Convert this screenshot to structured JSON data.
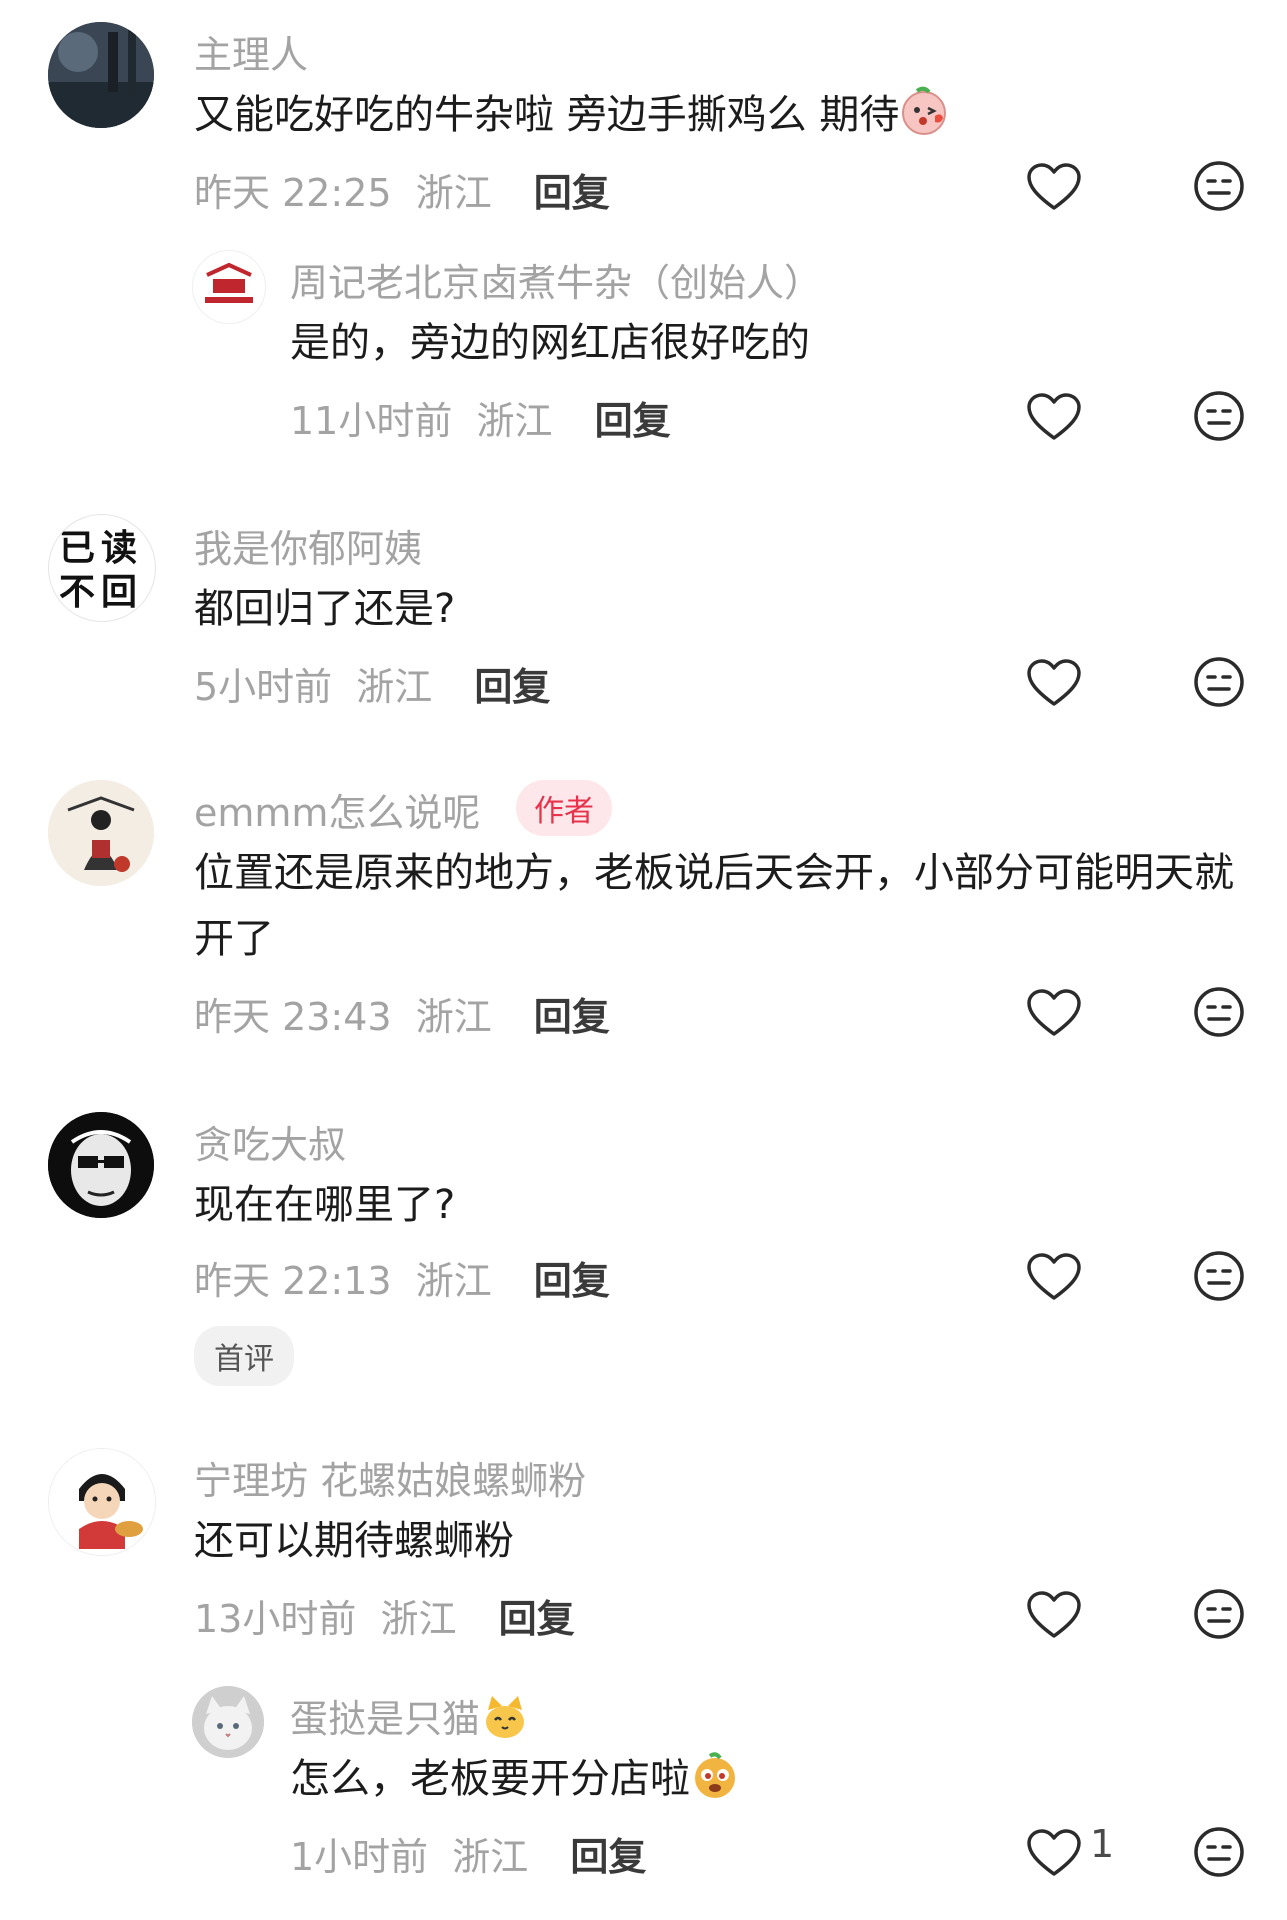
{
  "comments": [
    {
      "name": "主理人",
      "text": "又能吃好吃的牛杂啦   旁边手撕鸡么  期待",
      "emoji": "kiss-face-emoji",
      "time": "昨天 22:25",
      "location": "浙江",
      "reply_label": "回复",
      "replies": [
        {
          "name": "周记老北京卤煮牛杂（创始人）",
          "text": "是的，旁边的网红店很好吃的",
          "time": "11小时前",
          "location": "浙江",
          "reply_label": "回复"
        }
      ]
    },
    {
      "name": "我是你郁阿姨",
      "avatar_text": [
        "已读",
        "不回"
      ],
      "text": "都回归了还是?",
      "time": "5小时前",
      "location": "浙江",
      "reply_label": "回复"
    },
    {
      "name": "emmm怎么说呢",
      "tag": "作者",
      "text": "位置还是原来的地方，老板说后天会开，小部分可能明天就开了",
      "time": "昨天 23:43",
      "location": "浙江",
      "reply_label": "回复"
    },
    {
      "name": "贪吃大叔",
      "text": "现在在哪里了?",
      "time": "昨天 22:13",
      "location": "浙江",
      "reply_label": "回复",
      "badge": "首评"
    },
    {
      "name": "宁理坊 花螺姑娘螺蛳粉",
      "text": "还可以期待螺蛳粉",
      "time": "13小时前",
      "location": "浙江",
      "reply_label": "回复",
      "replies": [
        {
          "name": "蛋挞是只猫",
          "name_emoji": "cat-face-emoji",
          "text": "怎么，老板要开分店啦",
          "emoji": "goofy-face-emoji",
          "time": "1小时前",
          "location": "浙江",
          "reply_label": "回复",
          "likes": "1"
        }
      ]
    }
  ],
  "icons": {
    "like": "heart-outline-icon",
    "dislike": "meh-face-icon"
  },
  "colors": {
    "author_tag": "#e8324c",
    "secondary_text": "#a3a3a3"
  }
}
